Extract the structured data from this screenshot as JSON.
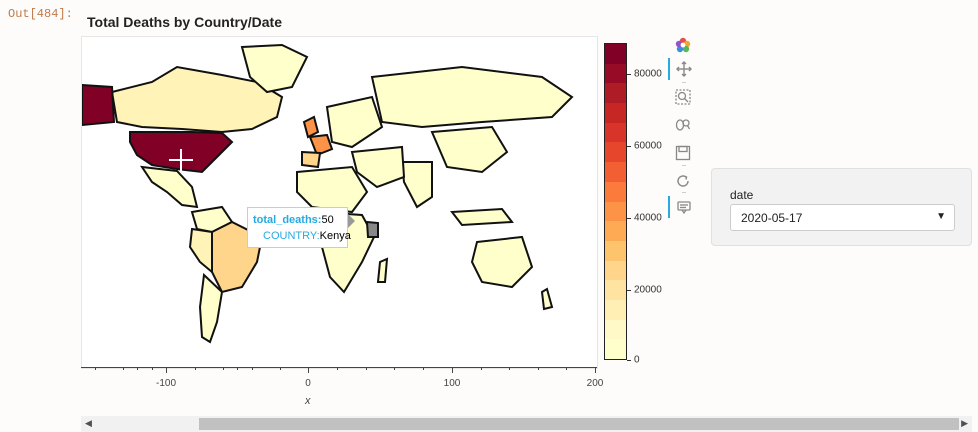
{
  "cell": {
    "prompt": "Out[484]:"
  },
  "plot": {
    "title": "Total Deaths by Country/Date"
  },
  "x_axis": {
    "label": "x",
    "ticks": [
      {
        "value": -100,
        "label": "-100"
      },
      {
        "value": 0,
        "label": "0"
      },
      {
        "value": 100,
        "label": "100"
      },
      {
        "value": 200,
        "label": "200"
      }
    ]
  },
  "colorbar": {
    "ticks": [
      {
        "value": 0,
        "label": "0"
      },
      {
        "value": 20000,
        "label": "20000"
      },
      {
        "value": 40000,
        "label": "40000"
      },
      {
        "value": 60000,
        "label": "60000"
      },
      {
        "value": 80000,
        "label": "80000"
      }
    ],
    "colors": [
      "#800026",
      "#970b26",
      "#ae1c25",
      "#c62624",
      "#d9342a",
      "#e6462c",
      "#f25f33",
      "#fb7a3c",
      "#fd9346",
      "#feaa55",
      "#fec36d",
      "#fed58a",
      "#ffe3a1",
      "#ffefb4",
      "#fff9c8",
      "#ffffcc"
    ]
  },
  "toolbar": {
    "tools": [
      {
        "name": "bokeh-logo-icon",
        "active": false
      },
      {
        "name": "pan-tool-icon",
        "active": true
      },
      {
        "name": "box-zoom-tool-icon",
        "active": false
      },
      {
        "name": "wheel-zoom-tool-icon",
        "active": false
      },
      {
        "name": "save-tool-icon",
        "active": false
      },
      {
        "name": "reset-tool-icon",
        "active": false
      },
      {
        "name": "hover-tool-icon",
        "active": true
      }
    ]
  },
  "widget": {
    "label": "date",
    "selected": "2020-05-17"
  },
  "tooltip": {
    "rows": [
      {
        "key": "total_deaths:",
        "value": "50"
      },
      {
        "key": "COUNTRY:",
        "value": "Kenya"
      }
    ]
  },
  "map": {
    "highlight_colors": {
      "usa": "#800026",
      "canada": "#fed58a",
      "uk_fr_it": "#fd9346",
      "brazil": "#fed58a",
      "default": "#ffffcc",
      "kenya_hover": "#888888"
    }
  }
}
